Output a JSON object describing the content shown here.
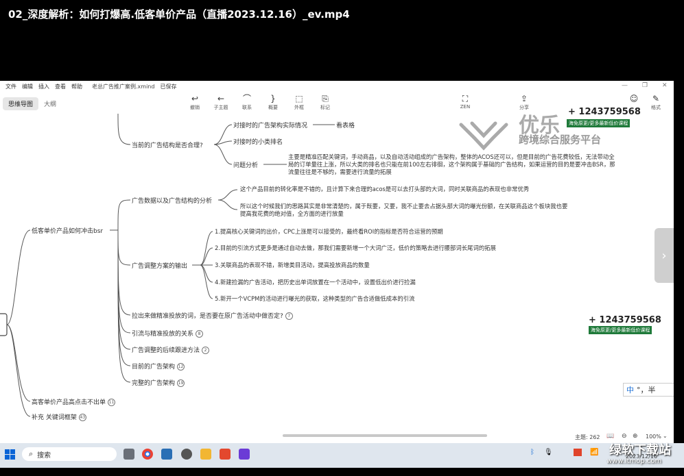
{
  "video_title": "02_深度解析：如何打爆高.低客单价产品（直播2023.12.16）_ev.mp4",
  "app": {
    "menu": [
      "文件",
      "编辑",
      "插入",
      "查看",
      "帮助"
    ],
    "filename": "老总广告推广案例.xmind",
    "saved": "已保存",
    "tabs": [
      "思维导图",
      "大纲"
    ],
    "tools": [
      {
        "icon": "↩",
        "label": "撤销"
      },
      {
        "icon": "←",
        "label": "子主题"
      },
      {
        "icon": "⌒",
        "label": "联系"
      },
      {
        "icon": "}",
        "label": "概要"
      },
      {
        "icon": "⬚",
        "label": "外框"
      },
      {
        "icon": "⎘",
        "label": "标记"
      }
    ],
    "right_tools": [
      {
        "icon": "⛶",
        "label": "ZEN"
      },
      {
        "icon": "⇪",
        "label": "分享"
      },
      {
        "icon": "☺",
        "label": ""
      },
      {
        "icon": "✎",
        "label": "格式"
      }
    ]
  },
  "mindmap": {
    "main1": {
      "label": "低客单价产品如何冲击bsr"
    },
    "main2": {
      "label": "高客单价产品高点击不出单",
      "badge": "11"
    },
    "main3": {
      "label": "补充 关键词框架",
      "badge": "43"
    },
    "b1": {
      "label": "当前的广告结构是否合理?",
      "children": [
        {
          "label": "对接时的广告架构实际情况",
          "note": "看表格"
        },
        {
          "label": "对接时的小类排名"
        },
        {
          "label": "问题分析"
        }
      ],
      "analysis": "主要是精准匹配关键词，手动商品，以及自动活动组成的广告架构，整体的ACOS还可以，但是目前的广告花费较低，无法带动全局的订单量往上涨，所以大类的排名也只能在前100左右徘徊，这个架构属于基础的广告结构，如果运营的目的是要冲击BSR，那流量往往是不够的，需要进行流量的拓展"
    },
    "b2": {
      "label": "广告数据以及广告结构的分析",
      "p1": "这个产品目前的转化率是不错的，且计算下来合理的acos是可以去打头部的大词，同时关联商品的表现也非常优秀",
      "p2": "所以这个时候我们的思路其实是非常清楚的，属于既要，又要，我不止要去占据头部大词的曝光份额，在关联商品这个板块我也要提高我花费的绝对值，全方面的进行放量"
    },
    "b3": {
      "label": "广告调整方案的输出",
      "items": [
        "1.提高核心关键词的出价，CPC上涨是可以接受的，最终看ROI的指标是否符合运营的预期",
        "2.目前的引流方式更多是通过自动去做，那我们需要新增一个大词广泛，低价的策略去进行腰部词长尾词的拓展",
        "3.关联商品的表现不错，新增类目活动，提高投放商品的数量",
        "4.新建捡漏的广告活动，把历史出单词放置在一个活动中，设置低出价进行捡漏",
        "5.新开一个VCPM的活动进行曝光的获取，这种类型的广告合适做低成本的引流"
      ]
    },
    "b4": {
      "label": "拉出来做精准投放的词，是否要在原广告活动中做否定?",
      "badge": "7"
    },
    "b5": {
      "label": "引流与精准投放的关系",
      "badge": "8"
    },
    "b6": {
      "label": "广告调整的后续跟进方法",
      "badge": "2"
    },
    "b7": {
      "label": "目前的广告架构",
      "badge": "12"
    },
    "b8": {
      "label": "完整的广告架构",
      "badge": "19"
    }
  },
  "watermark": {
    "phone1": "+ 1243759568",
    "phone2": "+ 1243759568",
    "green_text": "海免原更/更多最新低价课程",
    "brand_cn": "优乐",
    "brand_sub": "跨境综合服务平台"
  },
  "ime": {
    "cn": "中",
    "rest": "°，半"
  },
  "status": {
    "topics": "主题: 262",
    "zoom": "100%"
  },
  "taskbar": {
    "search_placeholder": "搜索",
    "date": "2023/12/16",
    "site_cn": "绿软下载站",
    "site_url": "www.itmop.com"
  }
}
